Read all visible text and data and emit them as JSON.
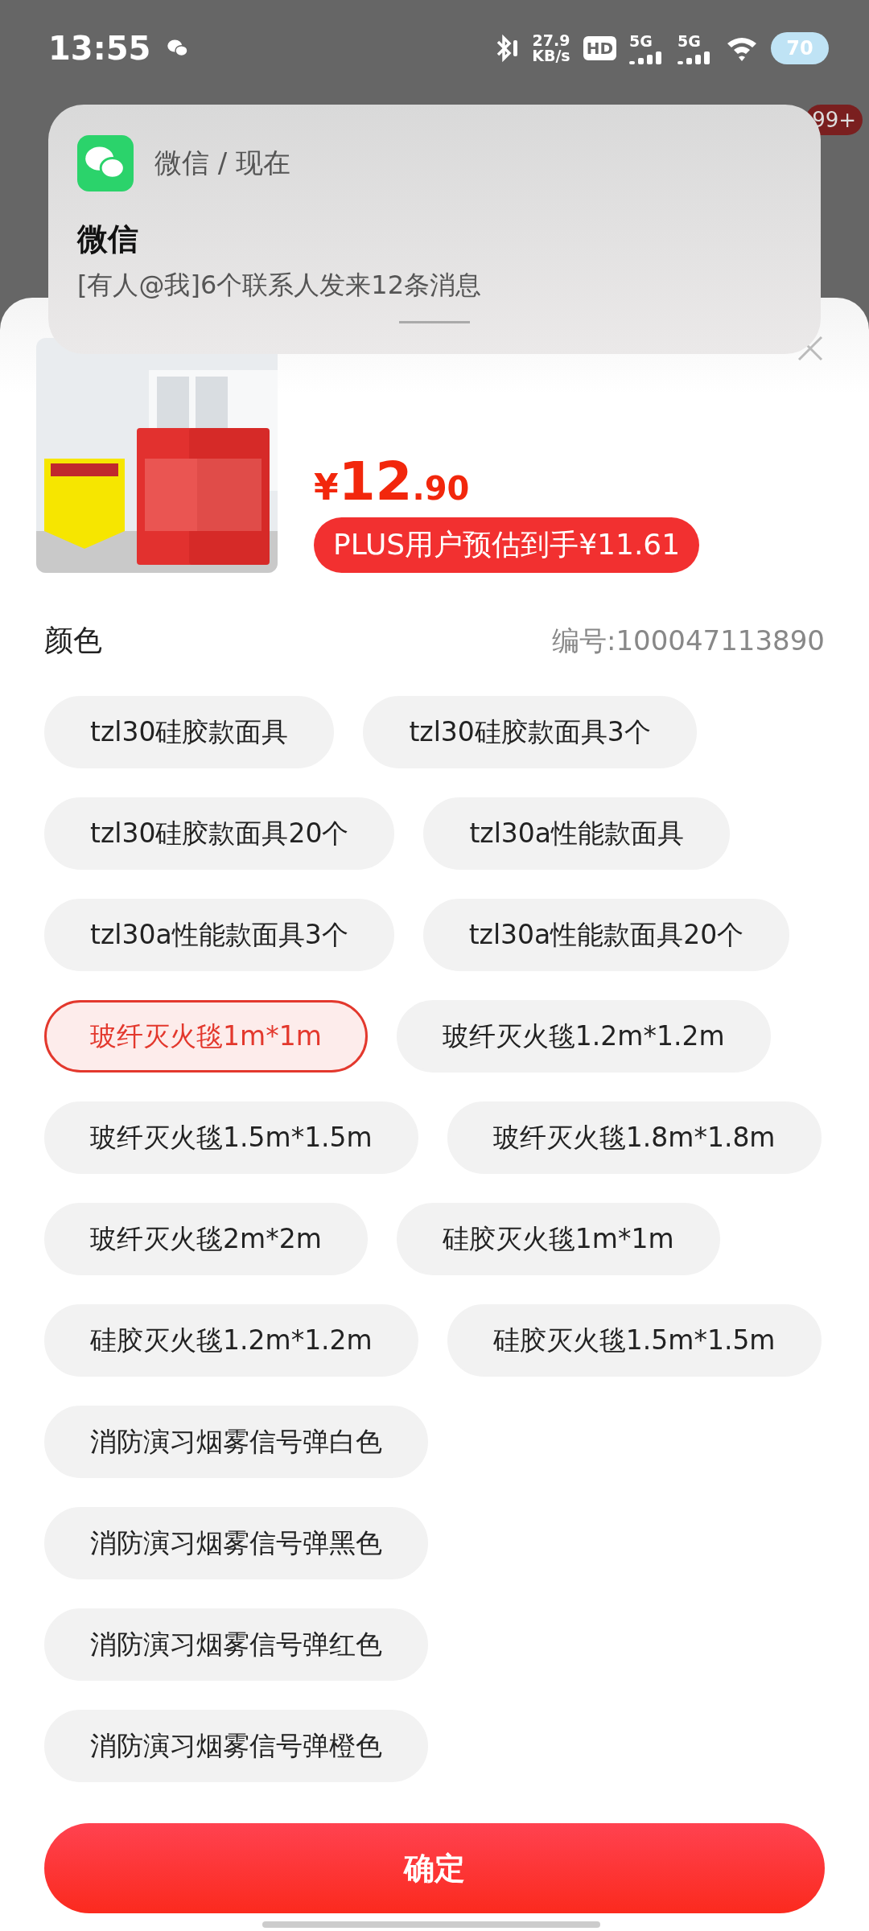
{
  "status_bar": {
    "time": "13:55",
    "net_speed": "27.9",
    "net_unit": "KB/s",
    "hd_label": "HD",
    "sims": [
      {
        "label": "5G"
      },
      {
        "label": "5G"
      }
    ],
    "battery": "70"
  },
  "background": {
    "badge": "99+"
  },
  "notification": {
    "app": "微信 / 现在",
    "title": "微信",
    "message": "[有人@我]6个联系人发来12条消息"
  },
  "product": {
    "price": {
      "currency": "¥",
      "integer": "12",
      "decimal": ".90"
    },
    "plus_price": "PLUS用户预估到手¥11.61"
  },
  "section": {
    "title": "颜色",
    "sku": "编号:100047113890"
  },
  "options": [
    {
      "label": "tzl30硅胶款面具",
      "selected": false
    },
    {
      "label": "tzl30硅胶款面具3个",
      "selected": false
    },
    {
      "label": "tzl30硅胶款面具20个",
      "selected": false
    },
    {
      "label": "tzl30a性能款面具",
      "selected": false
    },
    {
      "label": "tzl30a性能款面具3个",
      "selected": false
    },
    {
      "label": "tzl30a性能款面具20个",
      "selected": false
    },
    {
      "label": "玻纤灭火毯1m*1m",
      "selected": true
    },
    {
      "label": "玻纤灭火毯1.2m*1.2m",
      "selected": false
    },
    {
      "label": "玻纤灭火毯1.5m*1.5m",
      "selected": false
    },
    {
      "label": "玻纤灭火毯1.8m*1.8m",
      "selected": false
    },
    {
      "label": "玻纤灭火毯2m*2m",
      "selected": false
    },
    {
      "label": "硅胶灭火毯1m*1m",
      "selected": false
    },
    {
      "label": "硅胶灭火毯1.2m*1.2m",
      "selected": false
    },
    {
      "label": "硅胶灭火毯1.5m*1.5m",
      "selected": false
    },
    {
      "label": "消防演习烟雾信号弹白色",
      "selected": false
    },
    {
      "label": "消防演习烟雾信号弹黑色",
      "selected": false
    },
    {
      "label": "消防演习烟雾信号弹红色",
      "selected": false
    },
    {
      "label": "消防演习烟雾信号弹橙色",
      "selected": false
    }
  ],
  "confirm_button": "确定"
}
